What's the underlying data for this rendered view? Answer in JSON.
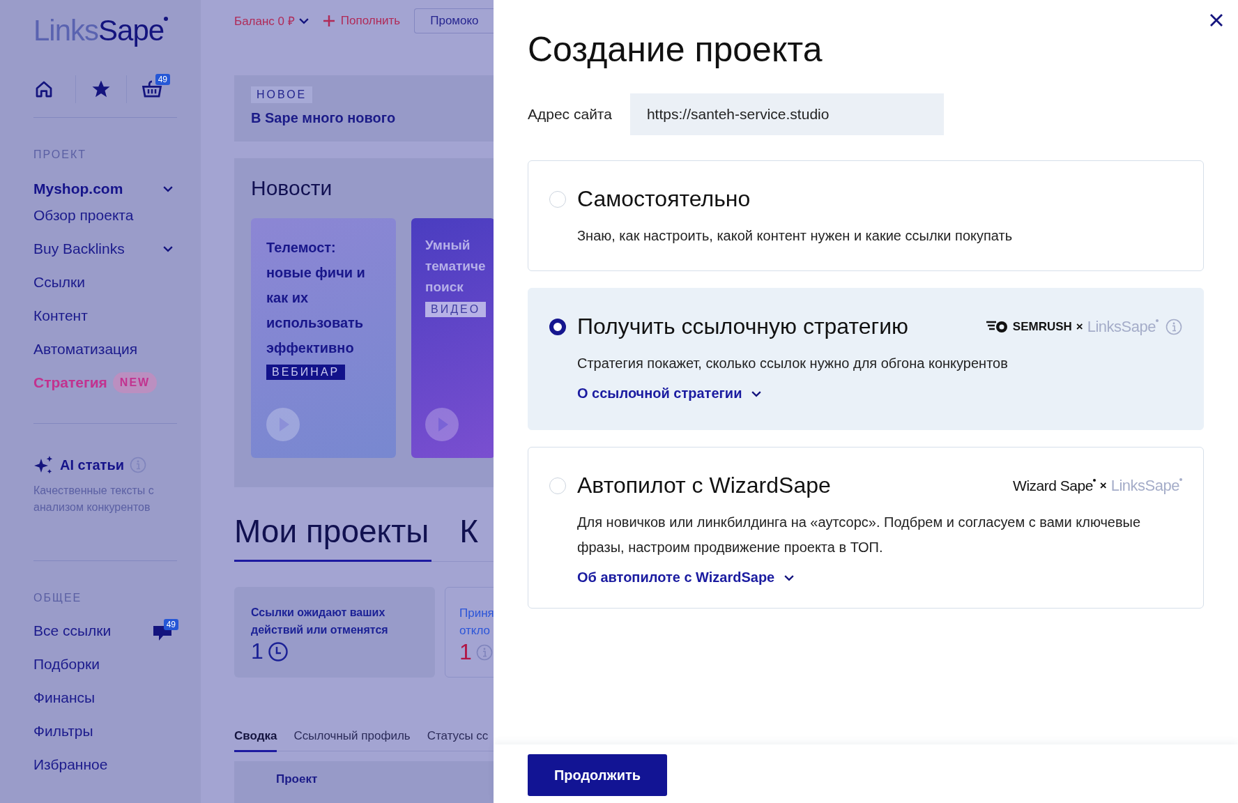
{
  "sidebar": {
    "logo": {
      "light": "Links",
      "dark": "Sape"
    },
    "quick_icons": [
      {
        "kind": "home"
      },
      {
        "kind": "star"
      },
      {
        "kind": "basket",
        "badge": "49"
      }
    ],
    "project_section": "ПРОЕКТ",
    "project": {
      "label": "Myshop.com",
      "expandable": true
    },
    "items": [
      {
        "label": "Обзор проекта",
        "selected": false,
        "expandable": false
      },
      {
        "label": "Buy Backlinks",
        "selected": false,
        "expandable": true
      },
      {
        "label": "Ссылки",
        "selected": false,
        "expandable": false
      },
      {
        "label": "Контент",
        "selected": false,
        "expandable": false
      },
      {
        "label": "Автоматизация",
        "selected": false,
        "expandable": false
      },
      {
        "label": "Стратегия",
        "selected": true,
        "expandable": false,
        "badge": "NEW"
      }
    ],
    "ai": {
      "title": "AI статьи",
      "description": "Качественные тексты с анализом конкурентов"
    },
    "general_section": "ОБЩЕЕ",
    "general_items": [
      {
        "label": "Все ссылки",
        "badge": "49"
      },
      {
        "label": "Подборки"
      },
      {
        "label": "Финансы"
      },
      {
        "label": "Фильтры"
      },
      {
        "label": "Избранное"
      }
    ]
  },
  "topbar": {
    "balance": "Баланс 0 ₽",
    "top_up": "Пополнить",
    "promo": "Промоко"
  },
  "banner": {
    "tag": "НОВОЕ",
    "title": "В Sape много нового"
  },
  "news": {
    "title": "Новости",
    "cards": [
      {
        "kind": "light",
        "title": "Телемост: новые фичи и как их использовать эффективно",
        "tag": "ВЕБИНАР"
      },
      {
        "kind": "dark",
        "title": "Умный тематиче поиск",
        "tag": "ВИДЕО"
      }
    ]
  },
  "headings": [
    {
      "label": "Мои проекты",
      "selected": true
    },
    {
      "label": "К",
      "selected": false
    }
  ],
  "stats": [
    {
      "kind": "pending",
      "lines": [
        "Ссылки ожидают ваших действий или отменятся"
      ],
      "value": "1"
    },
    {
      "kind": "info",
      "lines": [
        "Приня",
        "откло"
      ],
      "value": "1"
    }
  ],
  "tabs": [
    {
      "label": "Сводка",
      "selected": true
    },
    {
      "label": "Ссылочный профиль",
      "selected": false
    },
    {
      "label": "Статусы сс",
      "selected": false
    }
  ],
  "table": {
    "columns": [
      "Проект"
    ]
  },
  "modal": {
    "title": "Создание проекта",
    "address_label": "Адрес сайта",
    "address_value": "https://santeh-service.studio",
    "options": [
      {
        "selected": false,
        "title": "Самостоятельно",
        "description": "Знаю, как настроить, какой контент нужен и какие ссылки покупать"
      },
      {
        "selected": true,
        "title": "Получить ссылочную стратегию",
        "partner": {
          "kind": "semrush",
          "name": "SEMRUSH",
          "times": "×",
          "light": "Links",
          "dark": "Sape"
        },
        "description": "Стратегия покажет, сколько ссылок нужно для обгона конкурентов",
        "link": "О ссылочной стратегии"
      },
      {
        "selected": false,
        "title": "Автопилот с WizardSape",
        "partner": {
          "kind": "wizard",
          "name": "Wizard Sape",
          "times": "×",
          "light": "Links",
          "dark": "Sape"
        },
        "description": "Для новичков или линкбилдинга на «аутсорс». Подбрем и согласуем с вами ключевые фразы, настроим продвижение проекта в ТОП.",
        "link": "Об автопилоте с WizardSape"
      }
    ],
    "continue": "Продолжить"
  }
}
